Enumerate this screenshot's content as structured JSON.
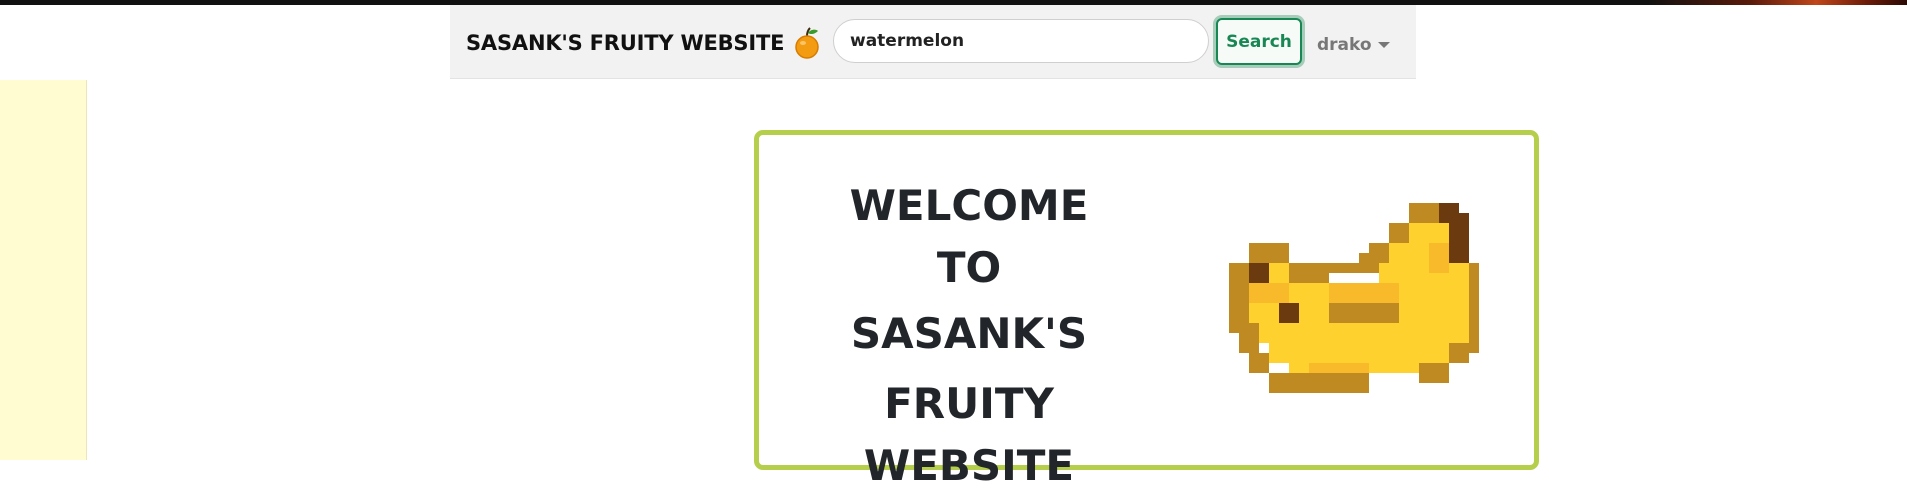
{
  "header": {
    "brand": "SASANK'S FRUITY WEBSITE",
    "brand_icon": "orange-icon",
    "search": {
      "value": "watermelon",
      "placeholder": ""
    },
    "search_button_label": "Search",
    "user_name": "drako",
    "accent_color": "#198754"
  },
  "main": {
    "welcome_lines": [
      "WELCOME",
      "TO",
      "SASANK'S FRUITY",
      "WEBSITE"
    ],
    "image_icon": "pixel-banana-icon",
    "card_border_color": "#b5cf4d"
  },
  "sidebar": {
    "background_color": "#fefcd0"
  }
}
